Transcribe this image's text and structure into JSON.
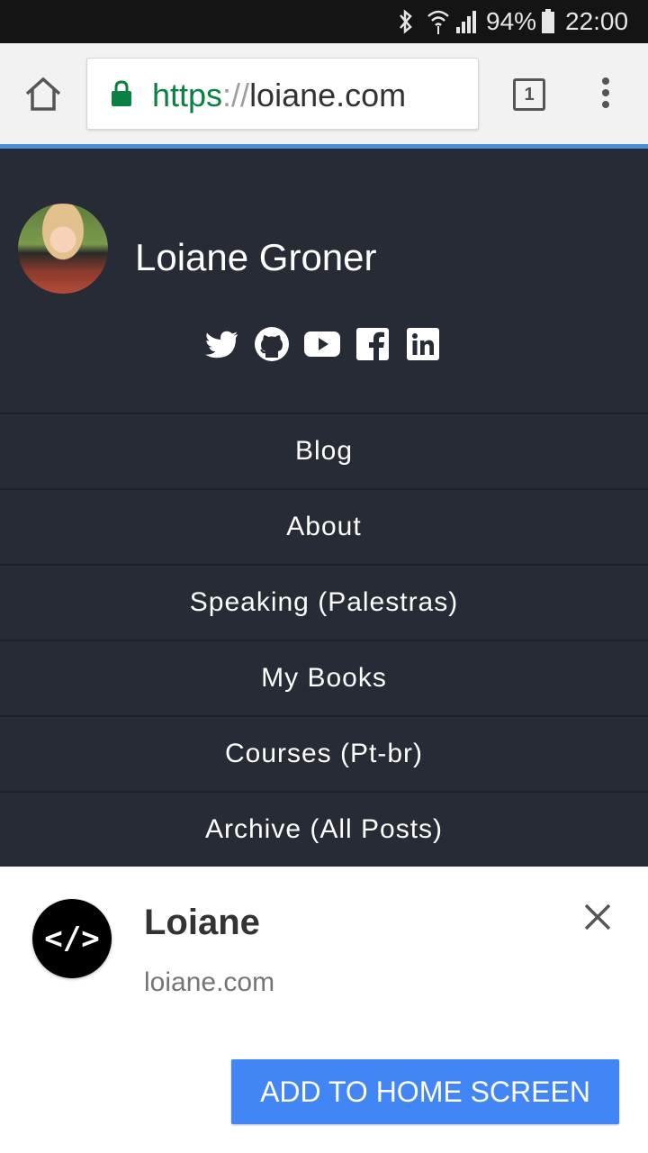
{
  "status_bar": {
    "battery_percent": "94%",
    "time": "22:00",
    "icons": [
      "bluetooth-icon",
      "wifi-icon",
      "signal-icon",
      "battery-icon"
    ]
  },
  "browser": {
    "url_scheme": "https",
    "url_separator": "://",
    "url_host": "loiane.com",
    "tab_count": "1",
    "icons": [
      "home-icon",
      "lock-icon",
      "tabs-icon",
      "overflow-menu-icon"
    ],
    "colors": {
      "scheme_green": "#0b8043",
      "progress_blue": "#4a90d9"
    }
  },
  "header": {
    "site_name": "Loiane Groner",
    "social_icons": [
      "twitter-icon",
      "github-icon",
      "youtube-icon",
      "facebook-icon",
      "linkedin-icon"
    ]
  },
  "nav": {
    "items": [
      {
        "label": "Blog"
      },
      {
        "label": "About"
      },
      {
        "label": "Speaking (Palestras)"
      },
      {
        "label": "My Books"
      },
      {
        "label": "Courses (Pt-br)"
      },
      {
        "label": "Archive (All Posts)"
      }
    ]
  },
  "install_banner": {
    "app_icon_text": "</>",
    "app_name": "Loiane",
    "app_url": "loiane.com",
    "add_button_label": "ADD TO HOME SCREEN",
    "colors": {
      "button_blue": "#4285f4"
    }
  }
}
